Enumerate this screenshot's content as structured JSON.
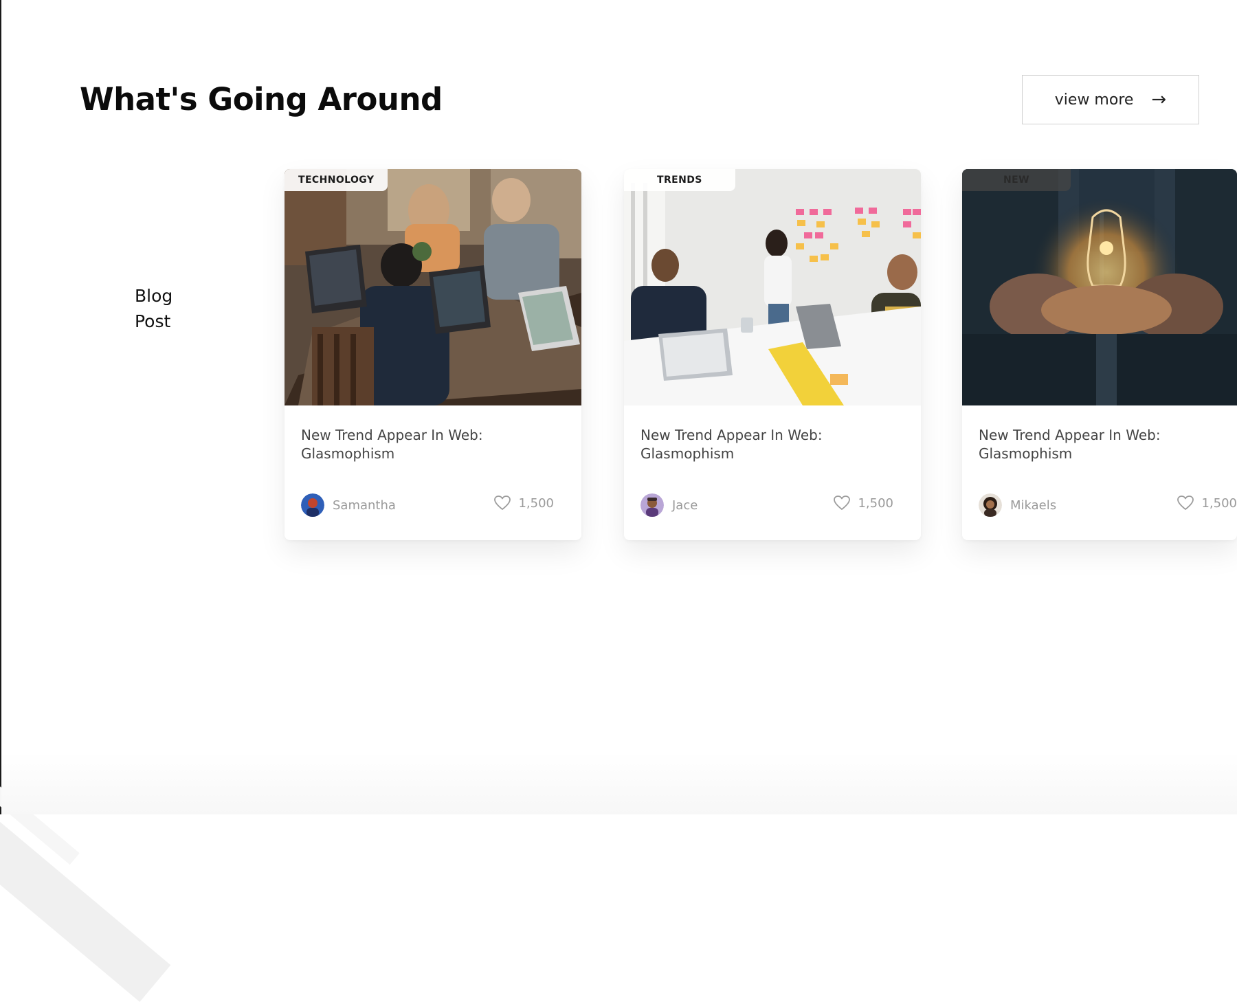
{
  "section": {
    "title": "What's Going Around",
    "view_more": "view more",
    "side_label_line1": "Blog",
    "side_label_line2": "Post"
  },
  "posts": [
    {
      "tag": "TECHNOLOGY",
      "title_line1": "New Trend Appear In Web:",
      "title_line2": "Glasmophism",
      "author": "Samantha",
      "likes": "1,500",
      "image": "photo of people working on laptops around a wooden table"
    },
    {
      "tag": "TRENDS",
      "title_line1": "New Trend Appear In Web:",
      "title_line2": "Glasmophism",
      "author": "Jace",
      "likes": "1,500",
      "image": "photo of a team meeting with sticky notes on a whiteboard"
    },
    {
      "tag": "NEW",
      "title_line1": "New Trend Appear In Web:",
      "title_line2": "Glasmophism",
      "author": "Mikaels",
      "likes": "1,500",
      "image": "photo of hands holding a glowing light bulb"
    }
  ],
  "icons": {
    "view_more": "arrow-right-icon",
    "likes": "heart-icon"
  }
}
